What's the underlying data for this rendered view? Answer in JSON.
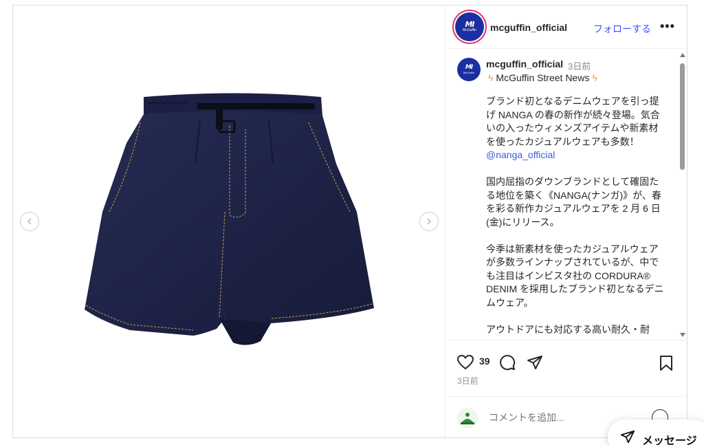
{
  "post": {
    "username": "mcguffin_official",
    "follow_label": "フォローする",
    "more_label": "•••",
    "avatar_mark": "MI",
    "avatar_text": "McGuffin"
  },
  "caption": {
    "username": "mcguffin_official",
    "time": "3日前",
    "title": "McGuffin Street News",
    "bolt": "ϟ",
    "lines_1": "ブランド初となるデニムウェアを引っ提げ NANGA の春の新作が続々登場。気合いの入ったウィメンズアイテムや新素材を使ったカジュアルウェアも多数！",
    "mention": "@nanga_official",
    "lines_2": "国内屈指のダウンブランドとして確固たる地位を築く《NANGA(ナンガ)》が、春を彩る新作カジュアルウェアを 2 月 6 日(金)にリリース。",
    "lines_3": "今季は新素材を使ったカジュアルウェアが多数ラインナップされているが、中でも注目はインビスタ社の CORDURA® DENIM を採用したブランド初となるデニムウェア。",
    "lines_4": "アウトドアにも対応する高い耐久・耐"
  },
  "actions": {
    "like_count": "39",
    "post_time": "3日前"
  },
  "comment": {
    "placeholder": "コメントを追加..."
  },
  "messages": {
    "label": "メッセージ"
  },
  "colors": {
    "accent_link": "#4150f7",
    "brand_avatar": "#1b2fa0",
    "denim": "#1f2446",
    "stitch": "#c9a04a"
  },
  "icons": {
    "like": "heart-icon",
    "comment": "comment-icon",
    "share": "paper-plane-icon",
    "save": "bookmark-icon",
    "prev": "chevron-left-icon",
    "next": "chevron-right-icon",
    "emoji": "emoji-icon",
    "messages": "paper-plane-icon"
  }
}
